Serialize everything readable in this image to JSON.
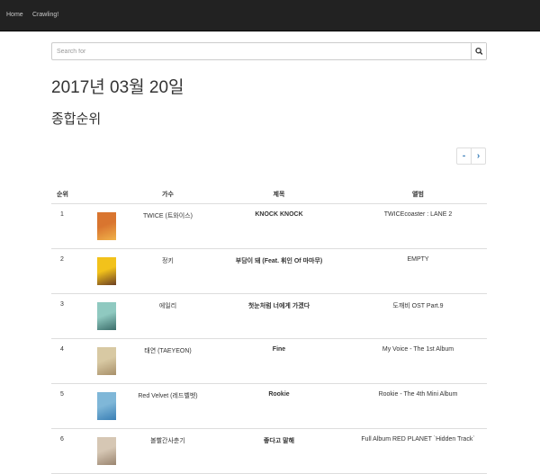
{
  "nav": {
    "home": "Home",
    "crawling": "Crawling!"
  },
  "search": {
    "placeholder": "Search for",
    "icon": "search-icon"
  },
  "date_title": "2017년 03월 20일",
  "subtitle": "종합순위",
  "pager": {
    "prev": "-",
    "next": "›"
  },
  "table": {
    "headers": [
      "순위",
      "",
      "가수",
      "제목",
      "앨범"
    ],
    "rows": [
      {
        "rank": "1",
        "artist": "TWICE (트와이스)",
        "title": "KNOCK KNOCK",
        "album": "TWICEcoaster : LANE 2",
        "cover_colors": [
          "#d9752f",
          "#f0b24a"
        ]
      },
      {
        "rank": "2",
        "artist": "정키",
        "title": "부담이 돼 (Feat. 휘인 Of 마마무)",
        "album": "EMPTY",
        "cover_colors": [
          "#f2c21b",
          "#6b3e22"
        ]
      },
      {
        "rank": "3",
        "artist": "에일리",
        "title": "첫눈처럼 너에게 가겠다",
        "album": "도깨비 OST Part.9",
        "cover_colors": [
          "#8fc9c0",
          "#3b6d6a"
        ]
      },
      {
        "rank": "4",
        "artist": "태연 (TAEYEON)",
        "title": "Fine",
        "album": "My Voice - The 1st Album",
        "cover_colors": [
          "#d8c9a3",
          "#a8906a"
        ]
      },
      {
        "rank": "5",
        "artist": "Red Velvet (레드벨벳)",
        "title": "Rookie",
        "album": "Rookie - The 4th Mini Album",
        "cover_colors": [
          "#7fb7d8",
          "#3a7fb5"
        ]
      },
      {
        "rank": "6",
        "artist": "볼빨간사춘기",
        "title": "좋다고 말해",
        "album": "Full Album RED PLANET `Hidden Track`",
        "cover_colors": [
          "#d6c7b4",
          "#9a8570"
        ]
      }
    ]
  }
}
